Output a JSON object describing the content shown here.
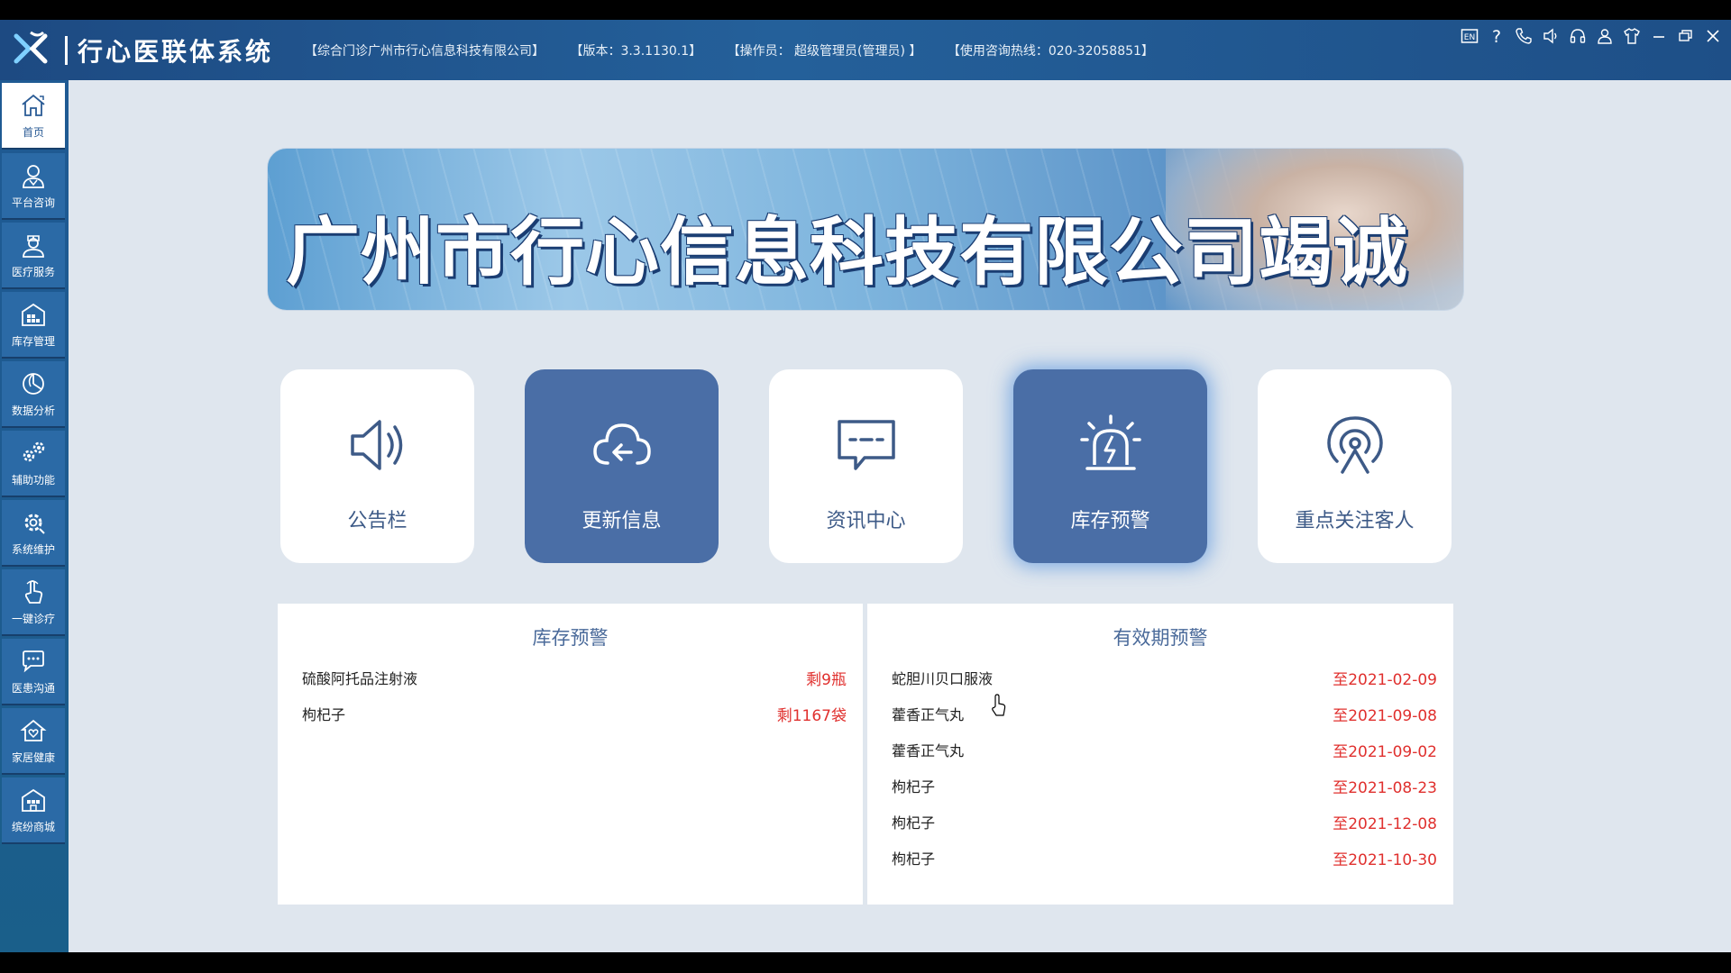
{
  "header": {
    "title": "行心医联体系统",
    "clinic": "【综合门诊广州市行心信息科技有限公司】",
    "version": "【版本：3.3.1130.1】",
    "operator": "【操作员：  超级管理员(管理员) 】",
    "hotline": "【使用咨询热线：020-32058851】",
    "window_icons": [
      {
        "name": "language-en-icon",
        "label": "EN"
      },
      {
        "name": "help-icon",
        "label": "?"
      },
      {
        "name": "phone-icon"
      },
      {
        "name": "volume-icon"
      },
      {
        "name": "headset-icon"
      },
      {
        "name": "user-icon"
      },
      {
        "name": "shirt-icon"
      },
      {
        "name": "minimize-icon"
      },
      {
        "name": "restore-icon"
      },
      {
        "name": "close-icon"
      }
    ]
  },
  "sidebar": {
    "items": [
      {
        "label": "首页",
        "icon": "home-icon",
        "active": true
      },
      {
        "label": "平台咨询",
        "icon": "doctor-icon"
      },
      {
        "label": "医疗服务",
        "icon": "nurse-icon"
      },
      {
        "label": "库存管理",
        "icon": "warehouse-icon"
      },
      {
        "label": "数据分析",
        "icon": "pie-chart-icon"
      },
      {
        "label": "辅助功能",
        "icon": "gears-icon"
      },
      {
        "label": "系统维护",
        "icon": "settings-icon"
      },
      {
        "label": "一键诊疗",
        "icon": "hand-pointer-icon"
      },
      {
        "label": "医患沟通",
        "icon": "chat-icon"
      },
      {
        "label": "家居健康",
        "icon": "home-health-icon"
      },
      {
        "label": "缤纷商城",
        "icon": "shop-icon"
      }
    ]
  },
  "banner": {
    "text": "广州市行心信息科技有限公司竭诚"
  },
  "cards": [
    {
      "label": "公告栏",
      "icon": "speaker-icon"
    },
    {
      "label": "更新信息",
      "icon": "cloud-update-icon"
    },
    {
      "label": "资讯中心",
      "icon": "message-icon"
    },
    {
      "label": "库存预警",
      "icon": "alarm-icon"
    },
    {
      "label": "重点关注客人",
      "icon": "broadcast-person-icon"
    }
  ],
  "stock_warning": {
    "title": "库存预警",
    "rows": [
      {
        "name": "硫酸阿托品注射液",
        "value": "剩9瓶"
      },
      {
        "name": "枸杞子",
        "value": "剩1167袋"
      }
    ]
  },
  "expiry_warning": {
    "title": "有效期预警",
    "rows": [
      {
        "name": "蛇胆川贝口服液",
        "value": "至2021-02-09"
      },
      {
        "name": "藿香正气丸",
        "value": "至2021-09-08"
      },
      {
        "name": "藿香正气丸",
        "value": "至2021-09-02"
      },
      {
        "name": "枸杞子",
        "value": "至2021-08-23"
      },
      {
        "name": "枸杞子",
        "value": "至2021-12-08"
      },
      {
        "name": "枸杞子",
        "value": "至2021-10-30"
      }
    ]
  },
  "colors": {
    "titlebar": "#1f5590",
    "sidebar": "#1f5a93",
    "card_active": "#4a6ea6",
    "warning_text": "#e0302e",
    "panel_title": "#4a6a9a"
  }
}
